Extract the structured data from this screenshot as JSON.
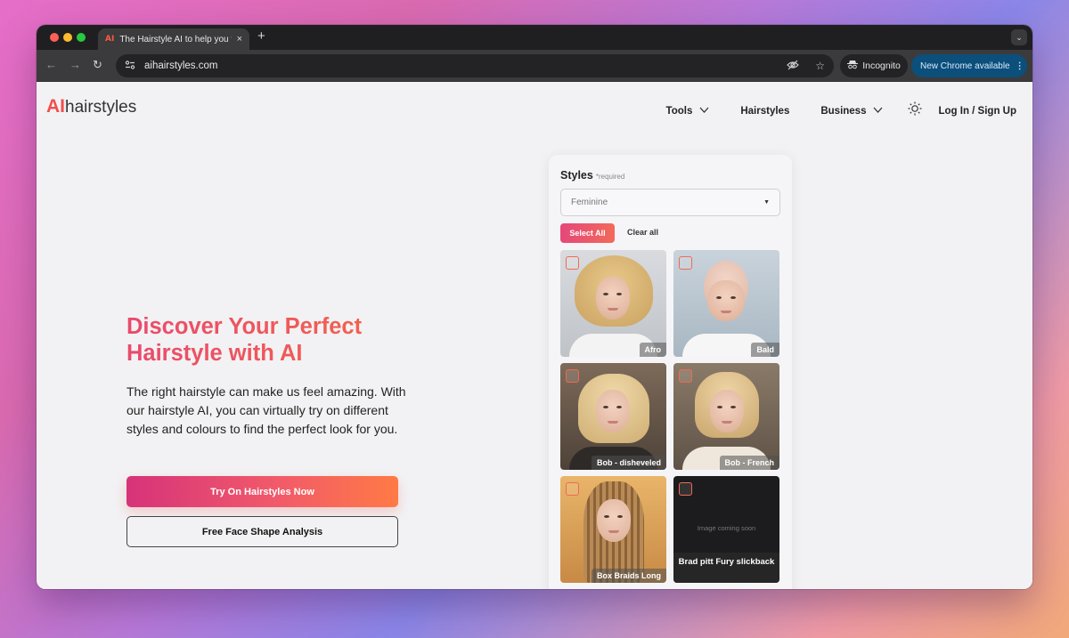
{
  "browser": {
    "tab_favicon": "AI",
    "tab_title": "The Hairstyle AI to help you fi",
    "tab_close": "×",
    "new_tab": "+",
    "tab_menu": "⌄",
    "url": "aihairstyles.com",
    "incognito_label": "Incognito",
    "update_label": "New Chrome available"
  },
  "site": {
    "logo_ai": "AI",
    "logo_text": "hairstyles",
    "nav": {
      "tools": "Tools",
      "hairstyles": "Hairstyles",
      "business": "Business",
      "login": "Log In / Sign Up"
    }
  },
  "hero": {
    "title": "Discover Your Perfect Hairstyle with AI",
    "description": "The right hairstyle can make us feel amazing. With our hairstyle AI, you can virtually try on different styles and colours to find the perfect look for you.",
    "primary_button": "Try On Hairstyles Now",
    "secondary_button": "Free Face Shape Analysis"
  },
  "styles_panel": {
    "label": "Styles",
    "required": "*required",
    "select_value": "Feminine",
    "select_all": "Select All",
    "clear_all": "Clear all",
    "tiles": [
      {
        "label": "Afro"
      },
      {
        "label": "Bald"
      },
      {
        "label": "Bob - disheveled"
      },
      {
        "label": "Bob - French"
      },
      {
        "label": "Box Braids Long"
      },
      {
        "label": "Brad pitt Fury slickback",
        "placeholder": "Image coming soon"
      }
    ]
  },
  "colors": {
    "accent": "#f24f4f",
    "gradient_start": "#d6337a",
    "gradient_end": "#ff7a45"
  }
}
